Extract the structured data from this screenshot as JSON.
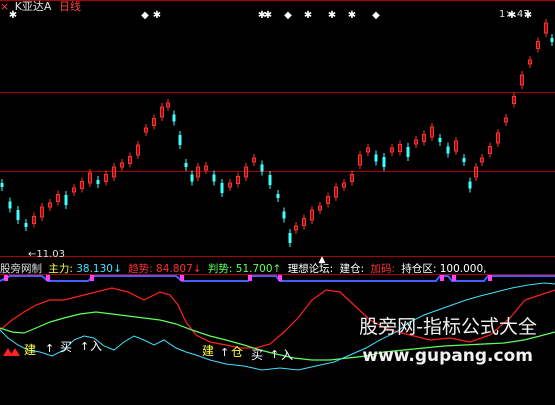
{
  "header": {
    "close_glyph": "×",
    "stock_name": "K亚达A",
    "period": "日线"
  },
  "price": {
    "high_label": "1×.47",
    "low_label": "←11.03"
  },
  "indicator": {
    "name": "股旁网制",
    "main_label": "主力:",
    "main_value": "38.130↓",
    "trend_label": "趋势:",
    "trend_value": "84.807↓",
    "judge_label": "判势:",
    "judge_value": "51.700↑",
    "forum_label": "理想论坛:",
    "build_label": "建仓:",
    "add_label": "加码:",
    "hold_label": "持仓区:",
    "hold_value": "100.000,"
  },
  "signals": {
    "s1": "建",
    "s2": "买",
    "s3": "建",
    "s4": "仓",
    "s5": "买",
    "s6": "入",
    "s7": "入"
  },
  "watermark": {
    "text": "股旁网-指标公式大全",
    "url": "www.gupang.com"
  },
  "colors": {
    "up": "#ff3030",
    "down": "#40ffff",
    "grid": "#aa0000",
    "trend": "#ff2020",
    "judge": "#60ff60",
    "main": "#40e0ff",
    "band": "#ff40ff",
    "yellow": "#ffff40"
  }
}
